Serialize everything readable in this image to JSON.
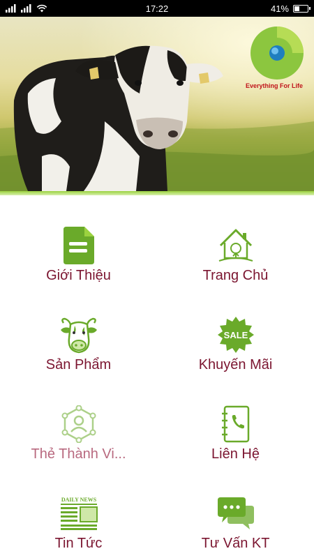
{
  "status_bar": {
    "time": "17:22",
    "battery": "41%",
    "battery_level": 0.41
  },
  "banner": {
    "logo_text": "Everything For Life"
  },
  "menu": {
    "items": [
      {
        "label": "Giới Thiệu",
        "icon": "document-icon"
      },
      {
        "label": "Trang Chủ",
        "icon": "home-icon"
      },
      {
        "label": "Sản Phẩm",
        "icon": "cow-icon"
      },
      {
        "label": "Khuyến Mãi",
        "icon": "sale-badge-icon"
      },
      {
        "label": "Thẻ Thành Vi...",
        "icon": "member-network-icon"
      },
      {
        "label": "Liên Hệ",
        "icon": "phone-book-icon"
      },
      {
        "label": "Tin Tức",
        "icon": "newspaper-icon",
        "icon_text": "DAILY NEWS"
      },
      {
        "label": "Tư Vấn KT",
        "icon": "chat-bubbles-icon"
      }
    ]
  },
  "colors": {
    "label": "#7b1530",
    "label_muted": "#b8697f",
    "icon_green": "#6aaa2a",
    "accent_green": "#9bd23f",
    "logo_red": "#c0131a"
  }
}
